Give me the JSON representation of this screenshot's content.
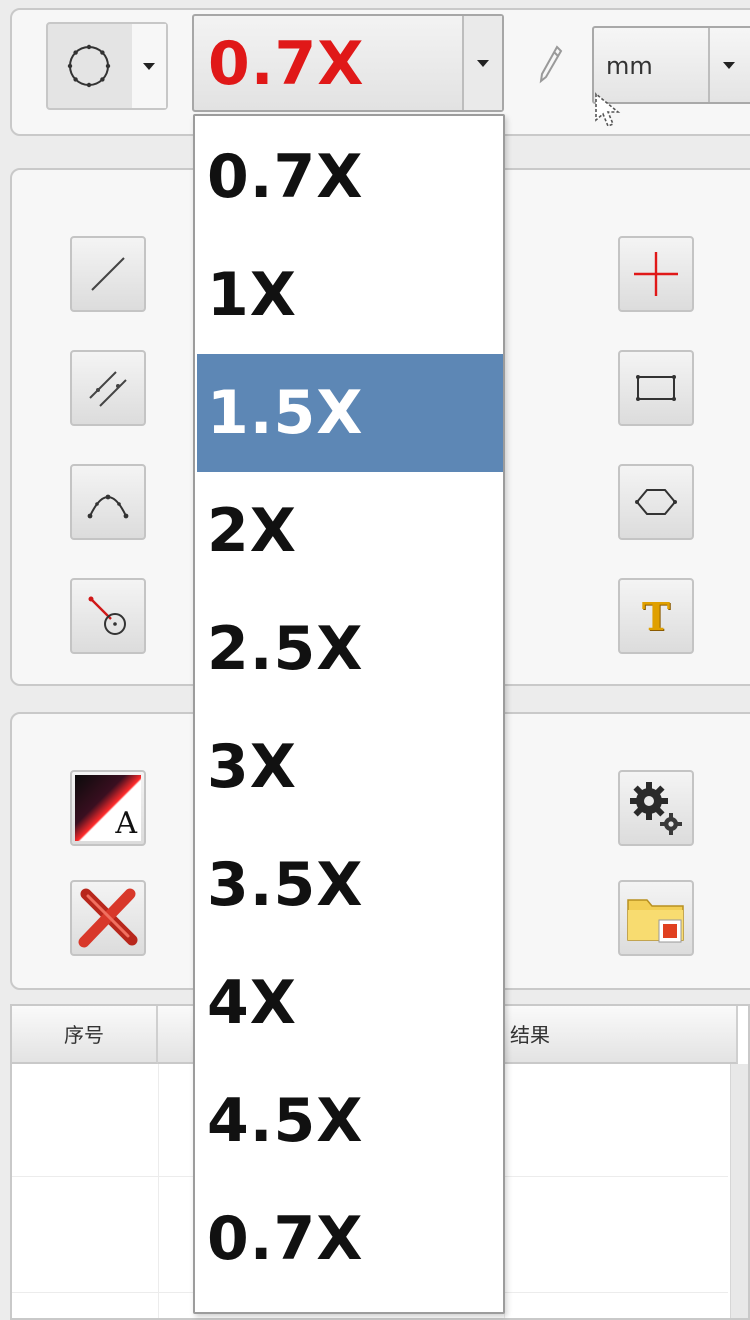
{
  "toolbar": {
    "shape_selector": {
      "icon": "circle-icon"
    },
    "zoom_combo": {
      "value": "0.7X",
      "value_color": "#e01818"
    },
    "pencil": {
      "icon": "pencil-icon"
    },
    "unit_combo": {
      "value": "mm"
    }
  },
  "tools": {
    "left_column": [
      {
        "icon": "line-icon"
      },
      {
        "icon": "parallel-lines-icon"
      },
      {
        "icon": "arc-icon"
      },
      {
        "icon": "line-to-circle-icon"
      }
    ],
    "right_column": [
      {
        "icon": "crosshair-icon"
      },
      {
        "icon": "rectangle-icon"
      },
      {
        "icon": "hexagon-icon"
      },
      {
        "icon": "text-icon",
        "glyph": "T"
      }
    ]
  },
  "actions": {
    "left_column": [
      {
        "icon": "font-color-icon",
        "glyph": "A"
      },
      {
        "icon": "delete-icon"
      }
    ],
    "right_column": [
      {
        "icon": "settings-gears-icon"
      },
      {
        "icon": "folder-save-icon"
      }
    ]
  },
  "table": {
    "columns": [
      "序号",
      "",
      "结果"
    ]
  },
  "zoom_dropdown": {
    "options": [
      "0.7X",
      "1X",
      "1.5X",
      "2X",
      "2.5X",
      "3X",
      "3.5X",
      "4X",
      "4.5X",
      "0.7X"
    ],
    "selected_index": 2,
    "highlight_color": "#5d87b5"
  }
}
